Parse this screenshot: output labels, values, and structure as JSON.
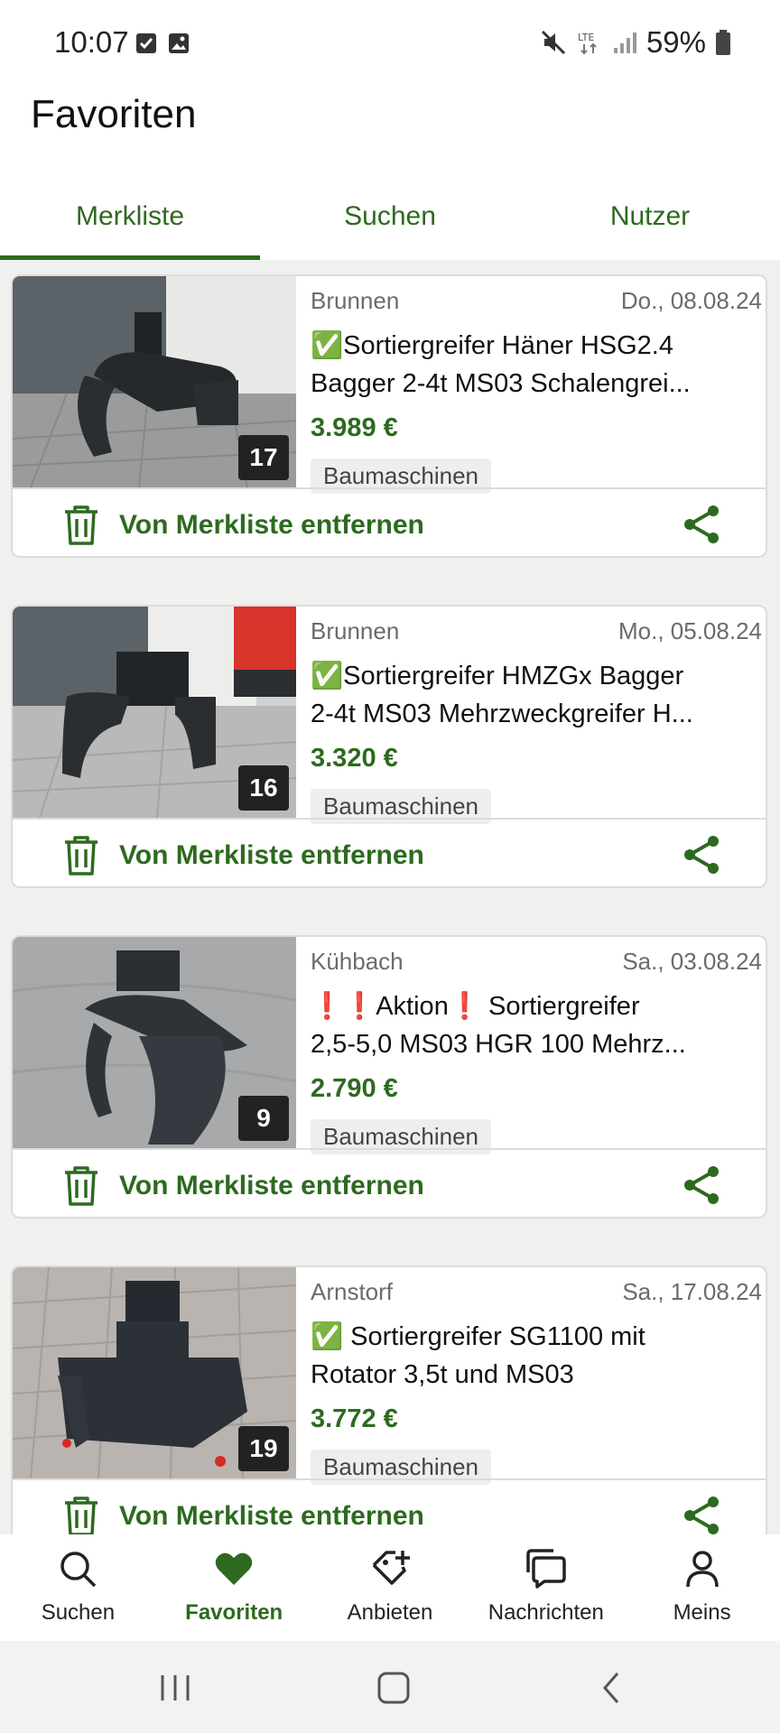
{
  "status_bar": {
    "time": "10:07",
    "battery": "59%",
    "network": "LTE"
  },
  "header": {
    "title": "Favoriten"
  },
  "tabs": [
    {
      "label": "Merkliste",
      "active": true
    },
    {
      "label": "Suchen",
      "active": false
    },
    {
      "label": "Nutzer",
      "active": false
    }
  ],
  "listings": [
    {
      "location": "Brunnen",
      "date": "Do., 08.08.24",
      "title_line1": "✅Sortiergreifer Häner HSG2.4",
      "title_line2": "Bagger 2-4t MS03 Schalengrei...",
      "price": "3.989 €",
      "category": "Baumaschinen",
      "photo_count": "17",
      "remove_label": "Von Merkliste entfernen"
    },
    {
      "location": "Brunnen",
      "date": "Mo., 05.08.24",
      "title_line1": "✅Sortiergreifer HMZGx Bagger",
      "title_line2": "2-4t MS03 Mehrzweckgreifer H...",
      "price": "3.320 €",
      "category": "Baumaschinen",
      "photo_count": "16",
      "remove_label": "Von Merkliste entfernen"
    },
    {
      "location": "Kühbach",
      "date": "Sa., 03.08.24",
      "title_line1": "❗❗Aktion❗ Sortiergreifer",
      "title_line2": "2,5-5,0 MS03 HGR 100 Mehrz...",
      "price": "2.790 €",
      "category": "Baumaschinen",
      "photo_count": "9",
      "remove_label": "Von Merkliste entfernen"
    },
    {
      "location": "Arnstorf",
      "date": "Sa., 17.08.24",
      "title_line1": "✅ Sortiergreifer SG1100 mit",
      "title_line2": "Rotator 3,5t und MS03",
      "price": "3.772 €",
      "category": "Baumaschinen",
      "photo_count": "19",
      "remove_label": "Von Merkliste entfernen"
    }
  ],
  "bottom_nav": [
    {
      "label": "Suchen",
      "icon": "search-icon",
      "active": false
    },
    {
      "label": "Favoriten",
      "icon": "heart-icon",
      "active": true
    },
    {
      "label": "Anbieten",
      "icon": "tag-plus-icon",
      "active": false
    },
    {
      "label": "Nachrichten",
      "icon": "chat-icon",
      "active": false
    },
    {
      "label": "Meins",
      "icon": "user-icon",
      "active": false
    }
  ],
  "colors": {
    "accent": "#2d6a1f",
    "background": "#f0f0ee",
    "text": "#111111"
  }
}
